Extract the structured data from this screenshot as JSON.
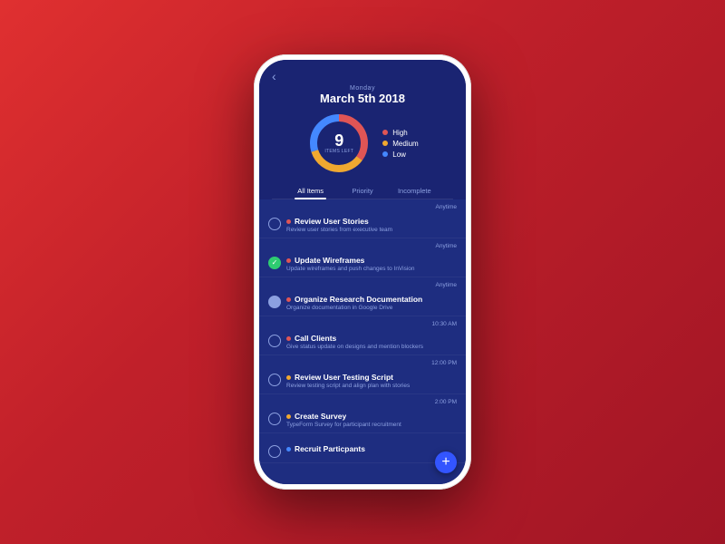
{
  "phone": {
    "header": {
      "day_label": "Monday",
      "date": "March 5th 2018",
      "back": "‹"
    },
    "donut": {
      "number": "9",
      "sub_line1": "ITEMS LEFT",
      "segments": [
        {
          "color": "#e05555",
          "pct": 35
        },
        {
          "color": "#f0a830",
          "pct": 35
        },
        {
          "color": "#4488ff",
          "pct": 30
        }
      ]
    },
    "legend": [
      {
        "label": "High",
        "color": "#e05555"
      },
      {
        "label": "Medium",
        "color": "#f0a830"
      },
      {
        "label": "Low",
        "color": "#4488ff"
      }
    ],
    "tabs": [
      {
        "label": "All Items",
        "active": true
      },
      {
        "label": "Priority",
        "active": false
      },
      {
        "label": "Incomplete",
        "active": false
      }
    ],
    "tasks": [
      {
        "time_label": "Anytime",
        "title": "Review User Stories",
        "desc": "Review user stories from executive team",
        "priority_color": "#e05555",
        "checkbox_state": "empty"
      },
      {
        "time_label": "Anytime",
        "title": "Update Wireframes",
        "desc": "Update wireframes and push changes to InVision",
        "priority_color": "#e05555",
        "checkbox_state": "completed"
      },
      {
        "time_label": "Anytime",
        "title": "Organize Research Documentation",
        "desc": "Organize documentation in Google Drive",
        "priority_color": "#e05555",
        "checkbox_state": "grey"
      },
      {
        "time_label": "10:30 AM",
        "title": "Call Clients",
        "desc": "Give status update on designs and mention blockers",
        "priority_color": "#e05555",
        "checkbox_state": "empty"
      },
      {
        "time_label": "12:00 PM",
        "title": "Review User Testing Script",
        "desc": "Review testing script and align plan with stories",
        "priority_color": "#f0a830",
        "checkbox_state": "empty"
      },
      {
        "time_label": "2:00 PM",
        "title": "Create Survey",
        "desc": "TypeForm Survey for participant recruitment",
        "priority_color": "#f0a830",
        "checkbox_state": "empty"
      },
      {
        "time_label": "",
        "title": "Recruit Particpants",
        "desc": "",
        "priority_color": "#4488ff",
        "checkbox_state": "empty"
      }
    ],
    "fab_label": "+"
  }
}
